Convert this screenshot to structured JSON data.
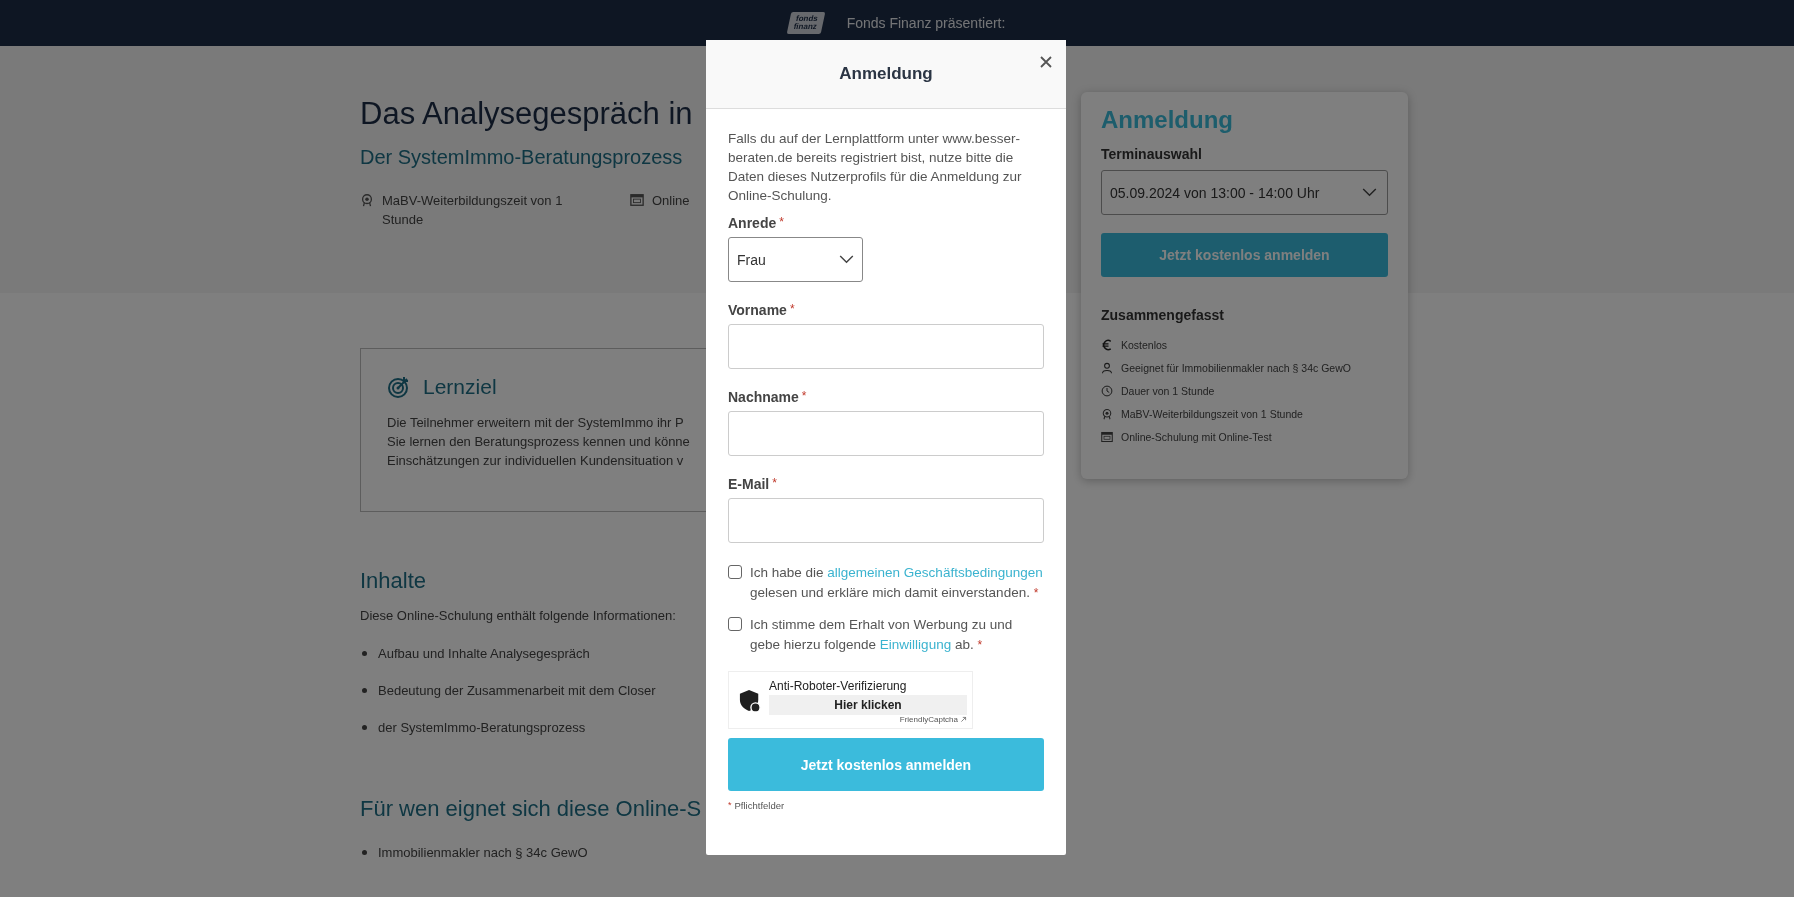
{
  "header": {
    "logo_text": "fonds finanz",
    "tagline": "Fonds Finanz präsentiert:"
  },
  "course": {
    "title": "Das Analysegespräch in",
    "subtitle": "Der SystemImmo-Beratungsprozess",
    "meta": [
      {
        "kind": "badge",
        "text": "MaBV-Weiterbildungszeit von 1 Stunde"
      },
      {
        "kind": "screen",
        "text": "Online"
      }
    ]
  },
  "lernziel": {
    "title": "Lernziel",
    "lines": [
      "Die Teilnehmer erweitern mit der SystemImmo ihr P",
      "Sie lernen den Beratungsprozess kennen und könne",
      "Einschätzungen zur individuellen Kundensituation v"
    ]
  },
  "inhalte": {
    "title": "Inhalte",
    "intro": "Diese Online-Schulung enthält folgende Informationen:",
    "items": [
      "Aufbau und Inhalte Analysegespräch",
      "Bedeutung der Zusammenarbeit mit dem Closer",
      "der SystemImmo-Beratungsprozess"
    ]
  },
  "zielgruppe": {
    "title": "Für wen eignet sich diese Online-S",
    "items": [
      "Immobilienmakler nach § 34c GewO"
    ]
  },
  "sidebar": {
    "title": "Anmeldung",
    "select_label": "Terminauswahl",
    "select_value": "05.09.2024 von 13:00 - 14:00 Uhr",
    "button": "Jetzt kostenlos anmelden",
    "summary_title": "Zusammengefasst",
    "summary": [
      {
        "kind": "euro",
        "text": "Kostenlos"
      },
      {
        "kind": "person",
        "text": "Geeignet für Immobilienmakler nach § 34c GewO"
      },
      {
        "kind": "clock",
        "text": "Dauer von 1 Stunde"
      },
      {
        "kind": "badge",
        "text": "MaBV-Weiterbildungszeit von 1 Stunde"
      },
      {
        "kind": "screen",
        "text": "Online-Schulung mit Online-Test"
      }
    ]
  },
  "modal": {
    "title": "Anmeldung",
    "intro": "Falls du auf der Lernplattform unter www.besser-beraten.de bereits registriert bist, nutze bitte die Daten dieses Nutzerprofils für die Anmeldung zur Online-Schulung.",
    "fields": [
      {
        "kind": "select",
        "label": "Anrede",
        "required_mark": "*",
        "value": "Frau"
      },
      {
        "kind": "text",
        "label": "Vorname",
        "required_mark": "*"
      },
      {
        "kind": "text",
        "label": "Nachname",
        "required_mark": "*"
      },
      {
        "kind": "text",
        "label": "E-Mail",
        "required_mark": "*"
      }
    ],
    "consents": [
      {
        "checked": false,
        "before": "Ich habe die ",
        "link": "allgemeinen Geschäftsbedingungen",
        "after": " gelesen und erkläre mich damit einverstanden.",
        "required_mark": "*"
      },
      {
        "checked": false,
        "before": "Ich stimme dem Erhalt von Werbung zu und gebe hierzu folgende ",
        "link": "Einwilligung",
        "after": " ab.",
        "required_mark": "*"
      }
    ],
    "captcha": {
      "label": "Anti-Roboter-Verifizierung",
      "button": "Hier klicken",
      "brand": "FriendlyCaptcha"
    },
    "submit": "Jetzt kostenlos anmelden",
    "note": {
      "mark": "*",
      "text": "Pflichtfelder"
    }
  }
}
